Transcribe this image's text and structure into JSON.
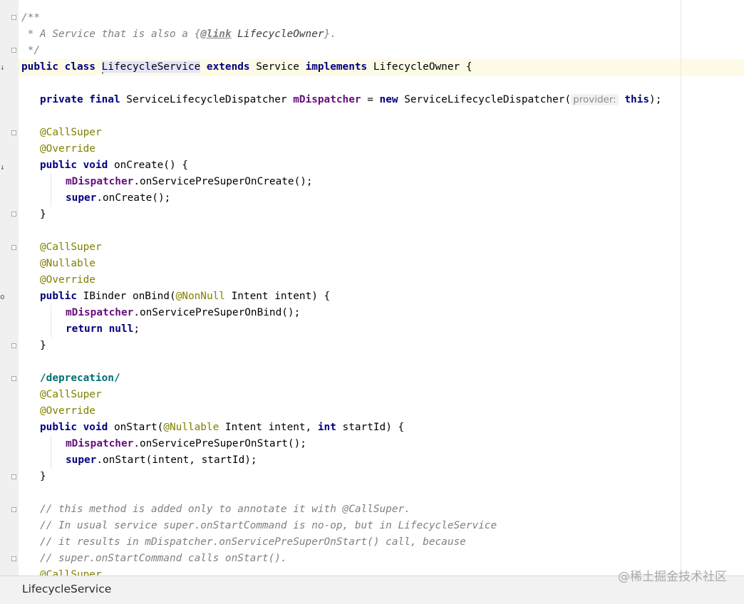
{
  "editor": {
    "lines": {
      "l1": "/**",
      "l2a": " * A Service that is also a {",
      "l2b": "@link",
      "l2c": " LifecycleOwner",
      "l2d": "}.",
      "l3": " */",
      "l4_kw1": "public class ",
      "l4_name": "LifecycleService",
      "l4_kw2": " extends ",
      "l4_super": "Service",
      "l4_kw3": " implements ",
      "l4_iface": "LifecycleOwner {",
      "l6_kw": "private final ",
      "l6_type": "ServiceLifecycleDispatcher ",
      "l6_field": "mDispatcher",
      "l6_eq": " = ",
      "l6_new": "new ",
      "l6_ctor": "ServiceLifecycleDispatcher(",
      "l6_hint": "provider:",
      "l6_this": "this",
      "l6_end": ");",
      "ann_callsuper": "@CallSuper",
      "ann_override": "@Override",
      "ann_nullable": "@Nullable",
      "m1_kw": "public void ",
      "m1_sig": "onCreate() {",
      "m1_b1_field": "mDispatcher",
      "m1_b1_call": ".onServicePreSuperOnCreate();",
      "m1_b2_kw": "super",
      "m1_b2_call": ".onCreate();",
      "close_brace": "}",
      "m2_kw": "public ",
      "m2_sig": "IBinder onBind(",
      "m2_ann": "@NonNull",
      "m2_rest": " Intent intent) {",
      "m2_b1_field": "mDispatcher",
      "m2_b1_call": ".onServicePreSuperOnBind();",
      "m2_b2_kw": "return null",
      "m2_b2_end": ";",
      "dep": "/deprecation/",
      "m3_kw": "public void ",
      "m3_sig": "onStart(",
      "m3_ann": "@Nullable",
      "m3_rest1": " Intent intent, ",
      "m3_int": "int",
      "m3_rest2": " startId) {",
      "m3_b1_field": "mDispatcher",
      "m3_b1_call": ".onServicePreSuperOnStart();",
      "m3_b2_kw": "super",
      "m3_b2_call": ".onStart(intent, startId);",
      "c1": "// this method is added only to annotate it with @CallSuper.",
      "c2": "// In usual service super.onStartCommand is no-op, but in LifecycleService",
      "c3": "// it results in mDispatcher.onServicePreSuperOnStart() call, because",
      "c4": "// super.onStartCommand calls onStart().",
      "cut": "@CallSuper"
    }
  },
  "statusbar": {
    "breadcrumb": "LifecycleService"
  },
  "watermark": "@稀土掘金技术社区"
}
